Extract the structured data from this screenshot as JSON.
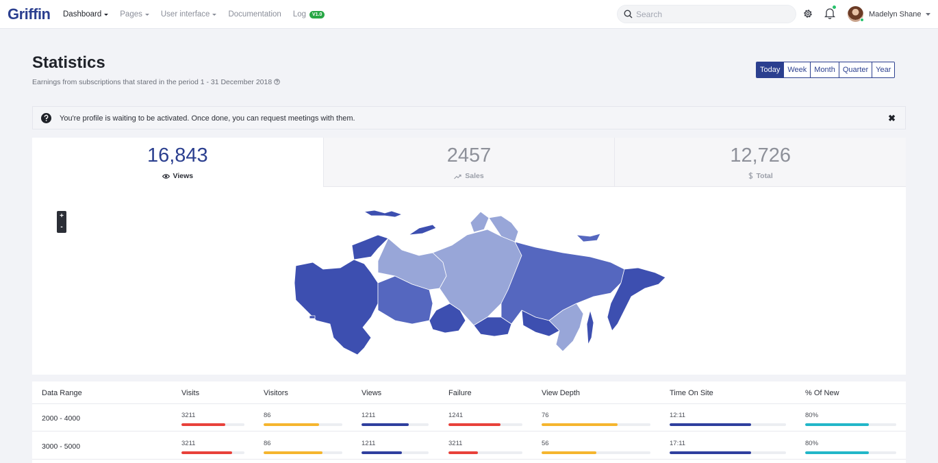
{
  "brand": "Griffin",
  "nav": [
    {
      "label": "Dashboard",
      "dropdown": true,
      "active": true
    },
    {
      "label": "Pages",
      "dropdown": true
    },
    {
      "label": "User interface",
      "dropdown": true
    },
    {
      "label": "Documentation",
      "dropdown": false
    },
    {
      "label": "Log",
      "dropdown": false,
      "badge": "V1.0"
    }
  ],
  "search": {
    "placeholder": "Search"
  },
  "user": {
    "name": "Madelyn Shane"
  },
  "header": {
    "title": "Statistics",
    "subtitle": "Earnings from subscriptions that stared in the period 1 - 31 December 2018"
  },
  "period": [
    "Today",
    "Week",
    "Month",
    "Quarter",
    "Year"
  ],
  "period_selected": "Today",
  "alert": {
    "text": "You're profile is waiting to be activated. Once done, you can request meetings with them."
  },
  "stats": [
    {
      "value": "16,843",
      "label": "Views",
      "icon": "eye-icon",
      "active": true
    },
    {
      "value": "2457",
      "label": "Sales",
      "icon": "trend-up-icon"
    },
    {
      "value": "12,726",
      "label": "Total",
      "icon": "dollar-icon"
    }
  ],
  "map": {
    "region": "Russia",
    "zoom_in": "+",
    "zoom_out": "-",
    "colors": [
      "#3d4fb0",
      "#5567bf",
      "#98a6d8"
    ]
  },
  "table": {
    "columns": [
      "Data Range",
      "Visits",
      "Visitors",
      "Views",
      "Failure",
      "View Depth",
      "Time On Site",
      "% Of New"
    ],
    "rows": [
      {
        "range": "2000 - 4000",
        "cells": [
          {
            "value": "3211",
            "pct": 0.7,
            "color": "#e8413a"
          },
          {
            "value": "86",
            "pct": 0.7,
            "color": "#f5b52e"
          },
          {
            "value": "1211",
            "pct": 0.7,
            "color": "#2f3f9e"
          },
          {
            "value": "1241",
            "pct": 0.7,
            "color": "#e8413a"
          },
          {
            "value": "76",
            "pct": 0.7,
            "color": "#f5b52e"
          },
          {
            "value": "12:11",
            "pct": 0.7,
            "color": "#2f3f9e"
          },
          {
            "value": "80%",
            "pct": 0.7,
            "color": "#22b6c8"
          }
        ]
      },
      {
        "range": "3000 - 5000",
        "cells": [
          {
            "value": "3211",
            "pct": 0.8,
            "color": "#e8413a"
          },
          {
            "value": "86",
            "pct": 0.75,
            "color": "#f5b52e"
          },
          {
            "value": "1211",
            "pct": 0.6,
            "color": "#2f3f9e"
          },
          {
            "value": "3211",
            "pct": 0.4,
            "color": "#e8413a"
          },
          {
            "value": "56",
            "pct": 0.5,
            "color": "#f5b52e"
          },
          {
            "value": "17:11",
            "pct": 0.7,
            "color": "#2f3f9e"
          },
          {
            "value": "80%",
            "pct": 0.7,
            "color": "#22b6c8"
          }
        ]
      }
    ]
  }
}
